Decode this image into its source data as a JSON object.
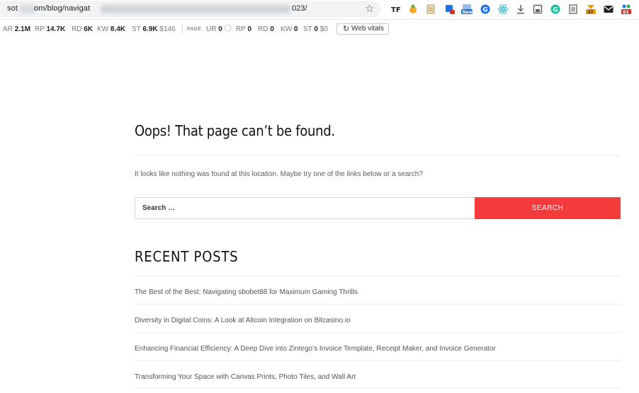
{
  "browser": {
    "url_start": "sot",
    "url_middle": "om/blog/navigat",
    "url_end": "023/",
    "extensions": [
      {
        "name": "ext-tf-icon",
        "color": "#1b1b1b"
      },
      {
        "name": "ext-bug-icon",
        "color": "#f4a72a"
      },
      {
        "name": "ext-clipboard-icon",
        "color": "#c9a56b"
      },
      {
        "name": "ext-puzzle-icon",
        "color": "#1a73e8",
        "badge": "",
        "badge_color": "#d93025"
      },
      {
        "name": "ext-new-icon",
        "color": "#1a73e8",
        "badge": "New",
        "badge_color": "#1a73e8"
      },
      {
        "name": "ext-g-icon",
        "color": "#1a73e8"
      },
      {
        "name": "ext-react-icon",
        "color": "#3fb9d6"
      },
      {
        "name": "ext-download-icon",
        "color": "#5f6368"
      },
      {
        "name": "ext-save-icon",
        "color": "#5f6368"
      },
      {
        "name": "ext-grammarly-icon",
        "color": "#15c39a"
      },
      {
        "name": "ext-trash-icon",
        "color": "#5f6368"
      },
      {
        "name": "ext-orange-icon",
        "color": "#f29900",
        "badge": "37",
        "badge_color": "#f29900"
      },
      {
        "name": "ext-mail-icon",
        "color": "#202124"
      },
      {
        "name": "ext-people-icon",
        "color": "#d93025",
        "badge": "63",
        "badge_color": "#d93025"
      }
    ]
  },
  "seo_bar": {
    "ar_label": "AR",
    "ar_value": "2.1M",
    "rp_label": "RP",
    "rp_value": "14.7K",
    "rd_label": "RD",
    "rd_value": "6K",
    "kw_label": "KW",
    "kw_value": "8.4K",
    "st_label": "ST",
    "st_value": "6.9K",
    "st_cost": "$146",
    "page_label": "PAGE",
    "ur_label": "UR",
    "ur_value": "0",
    "p_rp_label": "RP",
    "p_rp_value": "0",
    "p_rd_label": "RD",
    "p_rd_value": "0",
    "p_kw_label": "KW",
    "p_kw_value": "0",
    "p_st_label": "ST",
    "p_st_value": "0",
    "p_st_cost": "$0",
    "web_vitals_label": "Web vitals"
  },
  "page": {
    "title": "Oops! That page can’t be found.",
    "intro": "It looks like nothing was found at this location. Maybe try one of the links below or a search?",
    "search_placeholder": "Search …",
    "search_button": "SEARCH",
    "recent_heading": "RECENT POSTS",
    "posts": [
      "The Best of the Best: Navigating sbobet88 for Maximum Gaming Thrills",
      "Diversity in Digital Coins: A Look at Altcoin Integration on Bitcasino.io",
      "Enhancing Financial Efficiency: A Deep Dive into Zintego’s Invoice Template, Receipt Maker, and Invoice Generator",
      "Transforming Your Space with Canvas Prints, Photo Tiles, and Wall Art"
    ]
  },
  "colors": {
    "accent": "#f43b3b",
    "divider": "#ececec"
  }
}
